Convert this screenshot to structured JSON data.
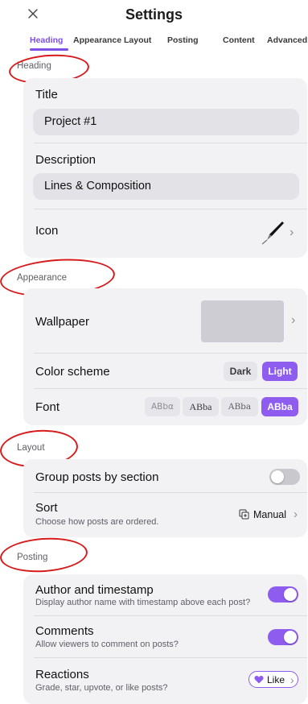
{
  "header": {
    "title": "Settings"
  },
  "tabs": [
    "Heading",
    "Appearance",
    "Layout",
    "Posting",
    "Content",
    "Advanced"
  ],
  "accent_color": "#8e5cef",
  "heading": {
    "section_label": "Heading",
    "title_label": "Title",
    "title_value": "Project #1",
    "description_label": "Description",
    "description_value": "Lines & Composition",
    "icon_label": "Icon",
    "icon_name": "pen-icon"
  },
  "appearance": {
    "section_label": "Appearance",
    "wallpaper_label": "Wallpaper",
    "color_scheme_label": "Color scheme",
    "color_scheme_options": [
      "Dark",
      "Light"
    ],
    "color_scheme_selected": "Light",
    "font_label": "Font",
    "font_options": [
      "ABbα",
      "ABba",
      "ABba",
      "ABba"
    ],
    "font_selected_index": 3
  },
  "layout": {
    "section_label": "Layout",
    "group_label": "Group posts by section",
    "group_enabled": false,
    "sort_label": "Sort",
    "sort_desc": "Choose how posts are ordered.",
    "sort_value": "Manual"
  },
  "posting": {
    "section_label": "Posting",
    "author_label": "Author and timestamp",
    "author_desc": "Display author name with timestamp above each post?",
    "author_enabled": true,
    "comments_label": "Comments",
    "comments_desc": "Allow viewers to comment on posts?",
    "comments_enabled": true,
    "reactions_label": "Reactions",
    "reactions_desc": "Grade, star, upvote, or like posts?",
    "reactions_value": "Like"
  }
}
